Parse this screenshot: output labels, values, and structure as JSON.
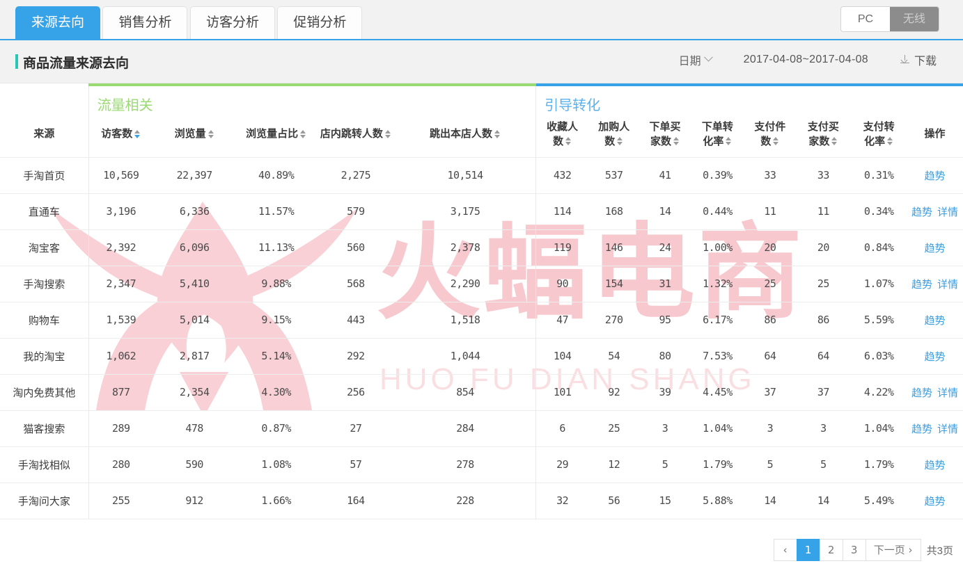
{
  "tabs": [
    {
      "label": "来源去向",
      "active": true
    },
    {
      "label": "销售分析",
      "active": false
    },
    {
      "label": "访客分析",
      "active": false
    },
    {
      "label": "促销分析",
      "active": false
    }
  ],
  "device_toggle": {
    "pc_label": "PC",
    "wireless_label": "无线",
    "selected": "无线"
  },
  "panel": {
    "title": "商品流量来源去向",
    "date_label": "日期",
    "date_range": "2017-04-08~2017-04-08",
    "download_label": "下载"
  },
  "colors": {
    "tab_active": "#36a3e8",
    "group_traffic": "#9ada72",
    "group_conversion": "#36a3e8",
    "link": "#3a9ee0",
    "title_accent": "#28c8b4",
    "watermark": "#f7c9ce"
  },
  "watermark": {
    "text": "火蝠电商",
    "subtext": "HUO FU DIAN SHANG"
  },
  "table": {
    "groups": [
      {
        "label": "流量相关",
        "color": "#9ada72"
      },
      {
        "label": "引导转化",
        "color": "#36a3e8"
      }
    ],
    "columns": [
      {
        "label": "来源",
        "sortable": false,
        "sort_active": false
      },
      {
        "label": "访客数",
        "sortable": true,
        "sort_active": true
      },
      {
        "label": "浏览量",
        "sortable": true,
        "sort_active": false
      },
      {
        "label": "浏览量占比",
        "sortable": true,
        "sort_active": false
      },
      {
        "label": "店内跳转人数",
        "sortable": true,
        "sort_active": false
      },
      {
        "label": "跳出本店人数",
        "sortable": true,
        "sort_active": false
      },
      {
        "label": "收藏人\n数",
        "sortable": true,
        "sort_active": false
      },
      {
        "label": "加购人\n数",
        "sortable": true,
        "sort_active": false
      },
      {
        "label": "下单买\n家数",
        "sortable": true,
        "sort_active": false
      },
      {
        "label": "下单转\n化率",
        "sortable": true,
        "sort_active": false
      },
      {
        "label": "支付件\n数",
        "sortable": true,
        "sort_active": false
      },
      {
        "label": "支付买\n家数",
        "sortable": true,
        "sort_active": false
      },
      {
        "label": "支付转\n化率",
        "sortable": true,
        "sort_active": false
      },
      {
        "label": "操作",
        "sortable": false,
        "sort_active": false
      }
    ],
    "rows": [
      {
        "source": "手淘首页",
        "visitors": "10,569",
        "pageviews": "22,397",
        "pv_share": "40.89%",
        "instore_jump": "2,275",
        "bounce_out": "10,514",
        "favorites": "432",
        "cart_adds": "537",
        "order_buyers": "41",
        "order_cvr": "0.39%",
        "paid_items": "33",
        "paid_buyers": "33",
        "pay_cvr": "0.31%",
        "actions": [
          "趋势"
        ]
      },
      {
        "source": "直通车",
        "visitors": "3,196",
        "pageviews": "6,336",
        "pv_share": "11.57%",
        "instore_jump": "579",
        "bounce_out": "3,175",
        "favorites": "114",
        "cart_adds": "168",
        "order_buyers": "14",
        "order_cvr": "0.44%",
        "paid_items": "11",
        "paid_buyers": "11",
        "pay_cvr": "0.34%",
        "actions": [
          "趋势",
          "详情"
        ]
      },
      {
        "source": "淘宝客",
        "visitors": "2,392",
        "pageviews": "6,096",
        "pv_share": "11.13%",
        "instore_jump": "560",
        "bounce_out": "2,378",
        "favorites": "119",
        "cart_adds": "146",
        "order_buyers": "24",
        "order_cvr": "1.00%",
        "paid_items": "20",
        "paid_buyers": "20",
        "pay_cvr": "0.84%",
        "actions": [
          "趋势"
        ]
      },
      {
        "source": "手淘搜索",
        "visitors": "2,347",
        "pageviews": "5,410",
        "pv_share": "9.88%",
        "instore_jump": "568",
        "bounce_out": "2,290",
        "favorites": "90",
        "cart_adds": "154",
        "order_buyers": "31",
        "order_cvr": "1.32%",
        "paid_items": "25",
        "paid_buyers": "25",
        "pay_cvr": "1.07%",
        "actions": [
          "趋势",
          "详情"
        ]
      },
      {
        "source": "购物车",
        "visitors": "1,539",
        "pageviews": "5,014",
        "pv_share": "9.15%",
        "instore_jump": "443",
        "bounce_out": "1,518",
        "favorites": "47",
        "cart_adds": "270",
        "order_buyers": "95",
        "order_cvr": "6.17%",
        "paid_items": "86",
        "paid_buyers": "86",
        "pay_cvr": "5.59%",
        "actions": [
          "趋势"
        ]
      },
      {
        "source": "我的淘宝",
        "visitors": "1,062",
        "pageviews": "2,817",
        "pv_share": "5.14%",
        "instore_jump": "292",
        "bounce_out": "1,044",
        "favorites": "104",
        "cart_adds": "54",
        "order_buyers": "80",
        "order_cvr": "7.53%",
        "paid_items": "64",
        "paid_buyers": "64",
        "pay_cvr": "6.03%",
        "actions": [
          "趋势"
        ]
      },
      {
        "source": "淘内免费其他",
        "visitors": "877",
        "pageviews": "2,354",
        "pv_share": "4.30%",
        "instore_jump": "256",
        "bounce_out": "854",
        "favorites": "101",
        "cart_adds": "92",
        "order_buyers": "39",
        "order_cvr": "4.45%",
        "paid_items": "37",
        "paid_buyers": "37",
        "pay_cvr": "4.22%",
        "actions": [
          "趋势",
          "详情"
        ]
      },
      {
        "source": "猫客搜索",
        "visitors": "289",
        "pageviews": "478",
        "pv_share": "0.87%",
        "instore_jump": "27",
        "bounce_out": "284",
        "favorites": "6",
        "cart_adds": "25",
        "order_buyers": "3",
        "order_cvr": "1.04%",
        "paid_items": "3",
        "paid_buyers": "3",
        "pay_cvr": "1.04%",
        "actions": [
          "趋势",
          "详情"
        ]
      },
      {
        "source": "手淘找相似",
        "visitors": "280",
        "pageviews": "590",
        "pv_share": "1.08%",
        "instore_jump": "57",
        "bounce_out": "278",
        "favorites": "29",
        "cart_adds": "12",
        "order_buyers": "5",
        "order_cvr": "1.79%",
        "paid_items": "5",
        "paid_buyers": "5",
        "pay_cvr": "1.79%",
        "actions": [
          "趋势"
        ]
      },
      {
        "source": "手淘问大家",
        "visitors": "255",
        "pageviews": "912",
        "pv_share": "1.66%",
        "instore_jump": "164",
        "bounce_out": "228",
        "favorites": "32",
        "cart_adds": "56",
        "order_buyers": "15",
        "order_cvr": "5.88%",
        "paid_items": "14",
        "paid_buyers": "14",
        "pay_cvr": "5.49%",
        "actions": [
          "趋势"
        ]
      }
    ]
  },
  "pagination": {
    "prev_label": "‹",
    "pages": [
      "1",
      "2",
      "3"
    ],
    "current": "1",
    "next_label": "下一页",
    "next_arrow": "›",
    "total_label": "共3页"
  }
}
